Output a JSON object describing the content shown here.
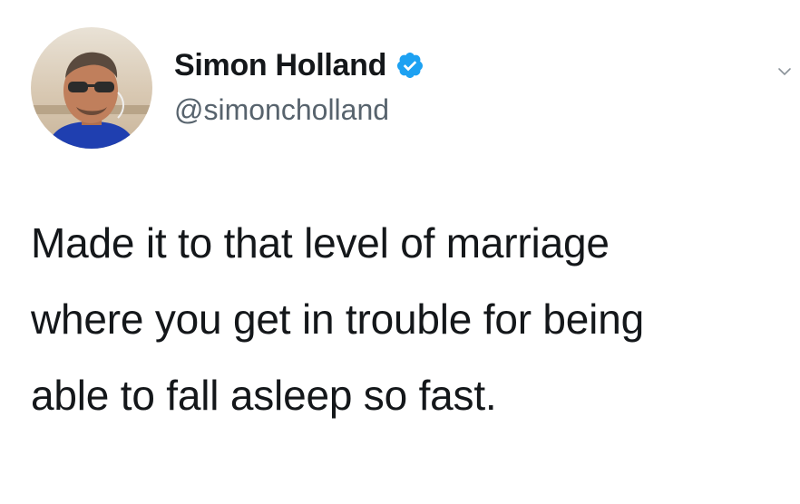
{
  "author": {
    "display_name": "Simon Holland",
    "handle": "@simoncholland",
    "verified": true,
    "verified_icon": "verified-badge-icon",
    "avatar_icon": "profile-photo"
  },
  "tweet": {
    "text": "Made it to that level of marriage\nwhere you get in trouble for being\nable to fall asleep so fast."
  },
  "menu": {
    "icon": "chevron-down-icon"
  },
  "colors": {
    "text": "#14171a",
    "secondary_text": "#57636d",
    "verified_blue": "#1da1f2",
    "background": "#ffffff"
  }
}
